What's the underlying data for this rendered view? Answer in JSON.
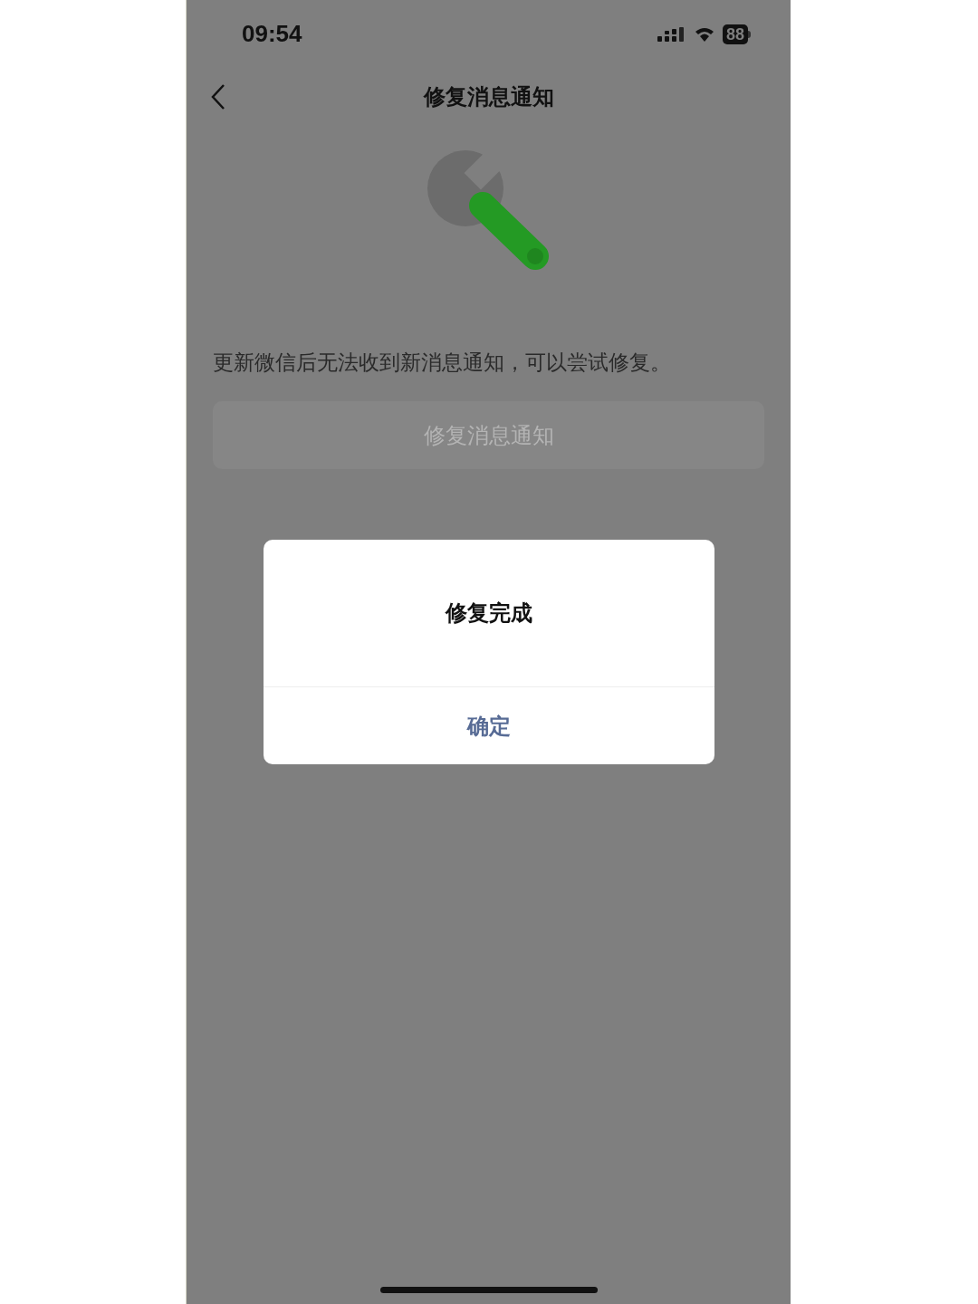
{
  "status_bar": {
    "time": "09:54",
    "battery": "88"
  },
  "nav": {
    "title": "修复消息通知"
  },
  "description": "更新微信后无法收到新消息通知，可以尝试修复。",
  "repair_button": {
    "label": "修复消息通知",
    "disabled": true
  },
  "dialog": {
    "title": "修复完成",
    "buttons": [
      "确定"
    ]
  }
}
